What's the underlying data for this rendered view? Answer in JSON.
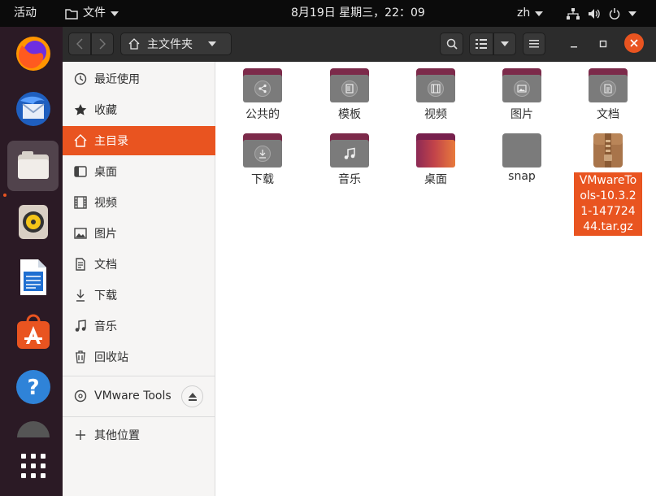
{
  "topbar": {
    "activities": "活动",
    "app_menu": "文件",
    "clock": "8月19日 星期三，22：09",
    "input_method": "zh"
  },
  "headerbar": {
    "path_label": "主文件夹"
  },
  "sidebar": {
    "items": [
      {
        "label": "最近使用",
        "icon": "clock-icon"
      },
      {
        "label": "收藏",
        "icon": "star-icon"
      },
      {
        "label": "主目录",
        "icon": "home-icon"
      },
      {
        "label": "桌面",
        "icon": "desktop-icon"
      },
      {
        "label": "视频",
        "icon": "video-icon"
      },
      {
        "label": "图片",
        "icon": "image-icon"
      },
      {
        "label": "文档",
        "icon": "document-icon"
      },
      {
        "label": "下载",
        "icon": "download-icon"
      },
      {
        "label": "音乐",
        "icon": "music-icon"
      },
      {
        "label": "回收站",
        "icon": "trash-icon"
      }
    ],
    "device": {
      "label": "VMware Tools",
      "icon": "disc-icon"
    },
    "other_locations": "其他位置"
  },
  "files": [
    {
      "label": "公共的",
      "icon": "share-icon"
    },
    {
      "label": "模板",
      "icon": "template-icon"
    },
    {
      "label": "视频",
      "icon": "video-icon"
    },
    {
      "label": "图片",
      "icon": "image-icon"
    },
    {
      "label": "文档",
      "icon": "document-icon"
    },
    {
      "label": "下载",
      "icon": "download-icon"
    },
    {
      "label": "音乐",
      "icon": "music-icon"
    },
    {
      "label": "桌面",
      "icon": "desktop-folder-icon"
    },
    {
      "label": "snap",
      "icon": "folder-icon"
    },
    {
      "label": "VMwareTools-10.3.21-14772444.tar.gz",
      "icon": "archive-icon"
    }
  ],
  "colors": {
    "accent": "#e95420",
    "dock": "#2b1a25",
    "folder_tab": "#7c2a4a",
    "folder_body": "#7b7b7b"
  }
}
